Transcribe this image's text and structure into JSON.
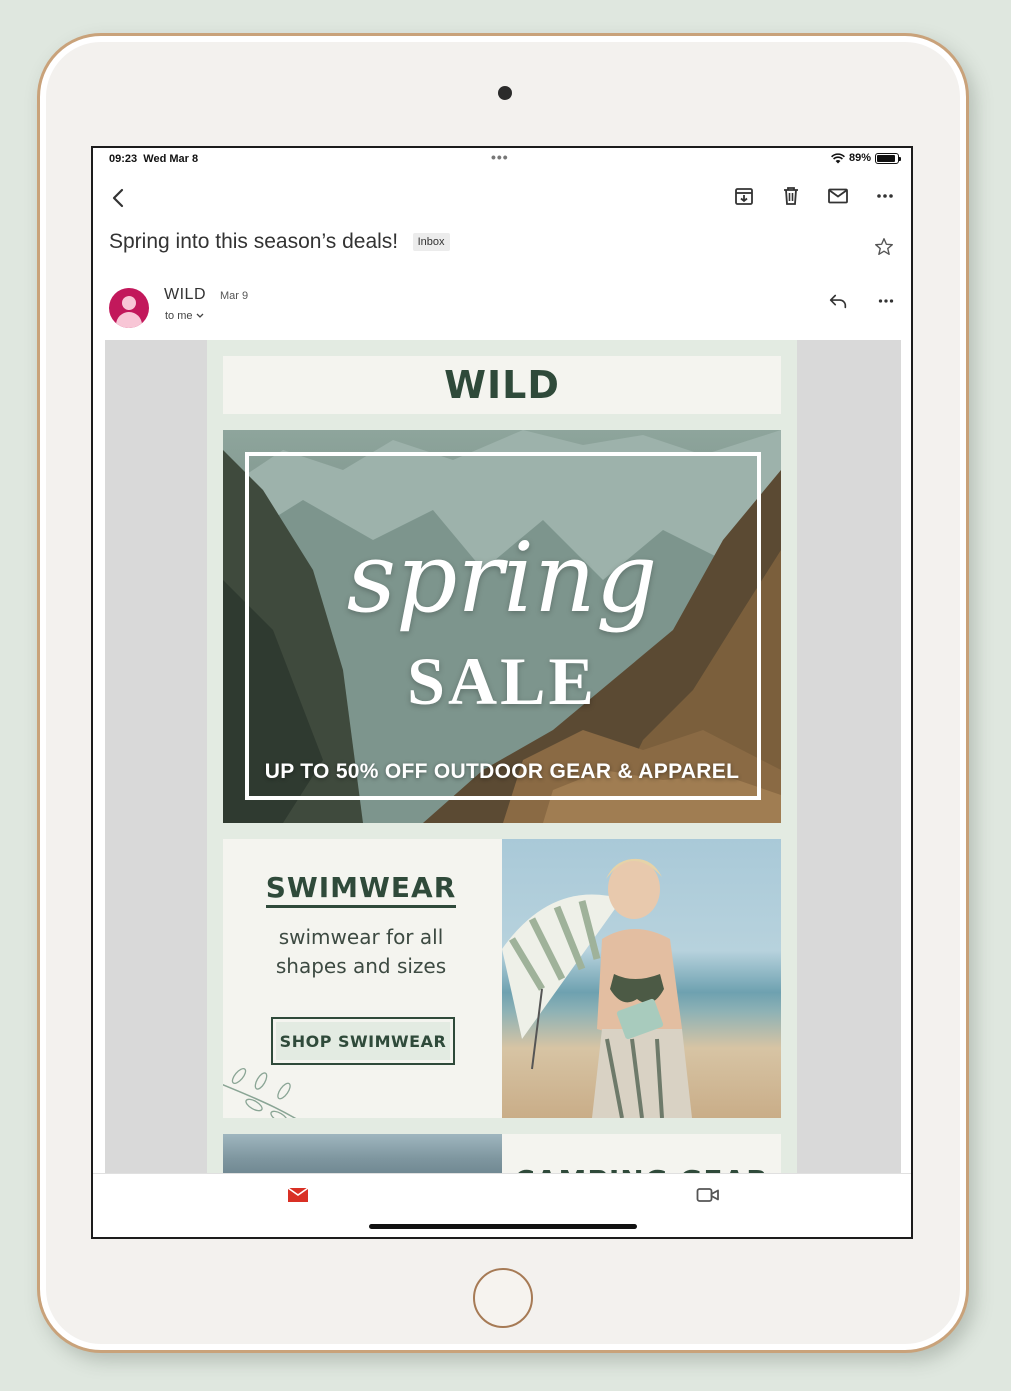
{
  "status": {
    "time": "09:23",
    "date": "Wed Mar 8",
    "dots": "•••",
    "battery": "89%",
    "battery_level": 0.89
  },
  "toolbar": {
    "icons": [
      "back-icon",
      "archive-icon",
      "trash-icon",
      "mail-icon",
      "more-icon"
    ]
  },
  "email": {
    "subject": "Spring into this season’s deals!",
    "label": "Inbox",
    "sender": "WILD",
    "date": "Mar 9",
    "recipient": "to me"
  },
  "newsletter": {
    "logo": "WILD",
    "hero": {
      "script": "spring",
      "title": "SALE",
      "offer": "UP TO 50% OFF OUTDOOR GEAR & APPAREL"
    },
    "promo": {
      "title": "SWIMWEAR",
      "subtitle_line1": "swimwear for all",
      "subtitle_line2": "shapes and sizes",
      "button": "SHOP SWIMWEAR"
    },
    "next_promo": {
      "title": "CAMPING GEAR"
    }
  },
  "colors": {
    "brand": "#2f4a3a",
    "mint": "#e3ebe2",
    "avatar": "#c2185b",
    "tab_active": "#d93025"
  }
}
